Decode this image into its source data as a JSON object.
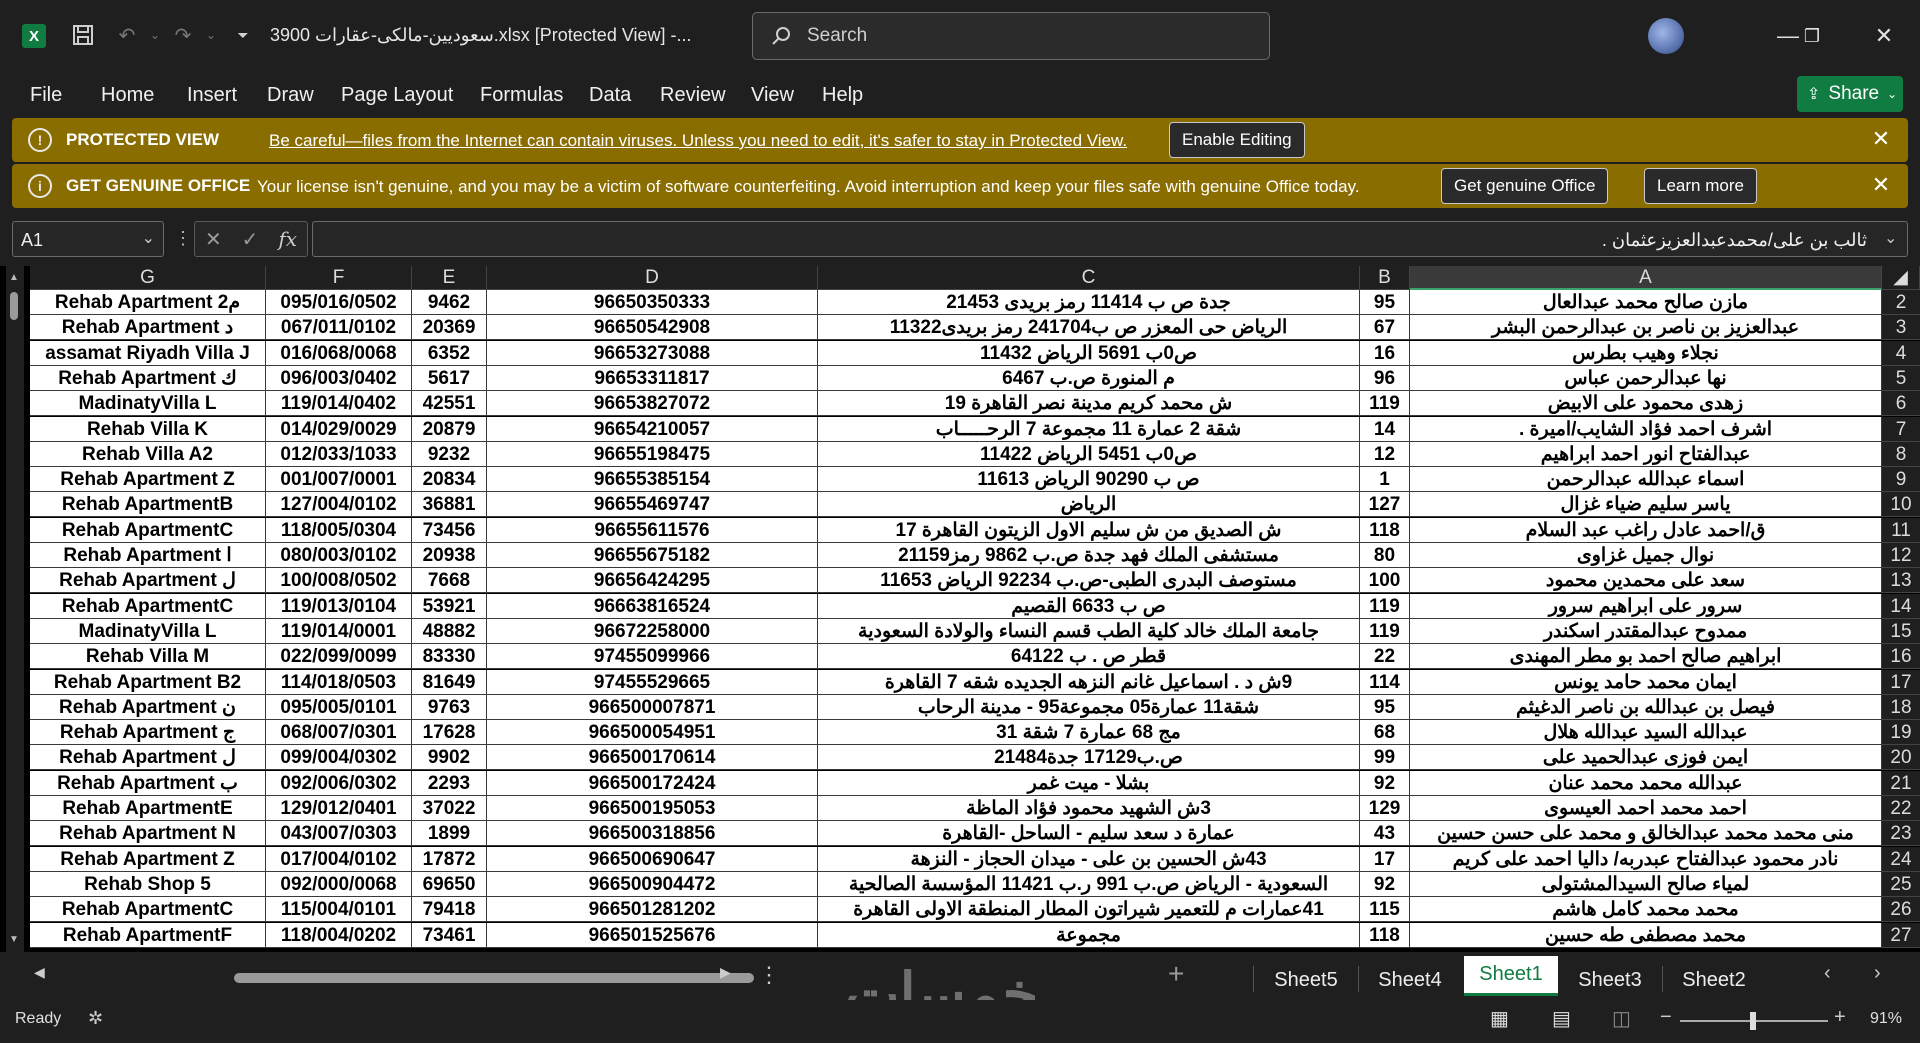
{
  "titlebar": {
    "app_letter": "X",
    "title": "3900 سعوديين-مالكى-عقارات.xlsx  [Protected View]  -...",
    "search_placeholder": "Search"
  },
  "menu": [
    "File",
    "Home",
    "Insert",
    "Draw",
    "Page Layout",
    "Formulas",
    "Data",
    "Review",
    "View",
    "Help"
  ],
  "share_label": "Share",
  "protected_bar": {
    "title": "PROTECTED VIEW",
    "text": "Be careful—files from the Internet can contain viruses. Unless you need to edit, it's safer to stay in Protected View.",
    "button": "Enable Editing"
  },
  "genuine_bar": {
    "title": "GET GENUINE OFFICE",
    "text": "Your license isn't genuine, and you may be a victim of software counterfeiting. Avoid interruption and keep your files safe with genuine Office today.",
    "button1": "Get genuine Office",
    "button2": "Learn more"
  },
  "formula_bar": {
    "name_box": "A1",
    "formula": "ثالب بن على/محمدعبدالعزيزعثمان ."
  },
  "columns": [
    "G",
    "F",
    "E",
    "D",
    "C",
    "B",
    "A"
  ],
  "rows": [
    {
      "n": "2",
      "A": "مازن صالح محمد عبدالعال",
      "B": "95",
      "C": "جدة ص ب 11414 رمز بريدى 21453",
      "D": "96650350333",
      "E": "9462",
      "F": "095/016/0502",
      "G": "Rehab Apartment 2م"
    },
    {
      "n": "3",
      "A": "عبدالعزيز بن ناصر بن عبدالرحمن  البشر",
      "B": "67",
      "C": "الرياض حى المعزر ص ب241704 رمز بريدى11322",
      "D": "96650542908",
      "E": "20369",
      "F": "067/011/0102",
      "G": "Rehab Apartment د"
    },
    {
      "n": "4",
      "A": "نجلاء  وهيب بطرس",
      "B": "16",
      "C": "ص0ب  5691 الرياض 11432",
      "D": "96653273088",
      "E": "6352",
      "F": "016/068/0068",
      "G": "assamat Riyadh Villa J"
    },
    {
      "n": "5",
      "A": "نها  عبدالرحمن عباس",
      "B": "96",
      "C": "م المنورة ص.ب 6467",
      "D": "96653311817",
      "E": "5617",
      "F": "096/003/0402",
      "G": "Rehab Apartment ك"
    },
    {
      "n": "6",
      "A": "زهدى محمود على الابيض",
      "B": "119",
      "C": "ش محمد كريم مدينة نصر القاهرة 19",
      "D": "96653827072",
      "E": "42551",
      "F": "119/014/0402",
      "G": "MadinatyVilla L"
    },
    {
      "n": "7",
      "A": "اشرف احمد فؤاد الشايب/اميرة .",
      "B": "14",
      "C": "شقة 2 عمارة 11 مجموعة 7 الرحـــــاب",
      "D": "96654210057",
      "E": "20879",
      "F": "014/029/0029",
      "G": "Rehab Villa K"
    },
    {
      "n": "8",
      "A": "عبدالفتاح  انور احمد ابراهيم",
      "B": "12",
      "C": "ص0ب 5451 الرياض 11422",
      "D": "96655198475",
      "E": "9232",
      "F": "012/033/1033",
      "G": "Rehab Villa A2"
    },
    {
      "n": "9",
      "A": "اسماء  عبدالله عبدالرحمن",
      "B": "1",
      "C": "ص ب 90290 الرياض 11613",
      "D": "96655385154",
      "E": "20834",
      "F": "001/007/0001",
      "G": "Rehab Apartment Z"
    },
    {
      "n": "10",
      "A": "ياسر سليم ضياء غزال",
      "B": "127",
      "C": "الرياض",
      "D": "96655469747",
      "E": "36881",
      "F": "127/004/0102",
      "G": "Rehab ApartmentB"
    },
    {
      "n": "11",
      "A": "ق/احمد عادل راغب عبد السلام",
      "B": "118",
      "C": "ش الصديق من ش سليم الاول الزيتون القاهرة 17",
      "D": "96655611576",
      "E": "73456",
      "F": "118/005/0304",
      "G": "Rehab ApartmentC"
    },
    {
      "n": "12",
      "A": "نوال  جميل غزاوى",
      "B": "80",
      "C": "مستشفى الملك فهد جدة ص.ب 9862 رمز21159",
      "D": "96655675182",
      "E": "20938",
      "F": "080/003/0102",
      "G": "Rehab Apartment ا"
    },
    {
      "n": "13",
      "A": "سعد على محمدين محمود",
      "B": "100",
      "C": "مستوصف البدرى الطبى-ص.ب 92234 الرياض 11653",
      "D": "96656424295",
      "E": "7668",
      "F": "100/008/0502",
      "G": "Rehab Apartment ل"
    },
    {
      "n": "14",
      "A": "سرور على ابراهيم سرور",
      "B": "119",
      "C": "ص ب 6633 القصيم",
      "D": "96663816524",
      "E": "53921",
      "F": "119/013/0104",
      "G": "Rehab ApartmentC"
    },
    {
      "n": "15",
      "A": "ممدوح عبدالمقتدر اسكندر",
      "B": "119",
      "C": "جامعة الملك خالد  كلية الطب  قسم النساء والولادة  السعودية",
      "D": "96672258000",
      "E": "48882",
      "F": "119/014/0001",
      "G": "MadinatyVilla L"
    },
    {
      "n": "16",
      "A": "ابراهيم صالح احمد بو مطر المهندى",
      "B": "22",
      "C": "قطر ص . ب 64122",
      "D": "97455099966",
      "E": "83330",
      "F": "022/099/0099",
      "G": "Rehab Villa M"
    },
    {
      "n": "17",
      "A": "ايمان محمد حامد يونس",
      "B": "114",
      "C": "9ش د . اسماعيل غانم النزهه الجديده شقه 7 القاهرة",
      "D": "97455529665",
      "E": "81649",
      "F": "114/018/0503",
      "G": "Rehab Apartment B2"
    },
    {
      "n": "18",
      "A": "فيصل بن عبدالله بن ناصر الدغيثم",
      "B": "95",
      "C": "شقة11 عمارة05 مجموعة95 - مدينة الرحاب",
      "D": "966500007871",
      "E": "9763",
      "F": "095/005/0101",
      "G": "Rehab Apartment ن"
    },
    {
      "n": "19",
      "A": "عبدالله السيد عبدالله هلال",
      "B": "68",
      "C": "مج 68 عمارة 7 شقة 31",
      "D": "966500054951",
      "E": "17628",
      "F": "068/007/0301",
      "G": "Rehab Apartment ج"
    },
    {
      "n": "20",
      "A": "ايمن  فوزى عبدالحميد على",
      "B": "99",
      "C": "ص.ب17129 جدة21484",
      "D": "966500170614",
      "E": "9902",
      "F": "099/004/0302",
      "G": "Rehab Apartment ل"
    },
    {
      "n": "21",
      "A": "عبدالله محمد محمد عنان",
      "B": "92",
      "C": "بشلا - ميت غمر",
      "D": "966500172424",
      "E": "2293",
      "F": "092/006/0302",
      "G": "Rehab Apartment ب"
    },
    {
      "n": "22",
      "A": "احمد محمد احمد العيسوى",
      "B": "129",
      "C": "3ش الشهيد محمود فؤاد الماظة",
      "D": "966500195053",
      "E": "37022",
      "F": "129/012/0401",
      "G": "Rehab ApartmentE"
    },
    {
      "n": "23",
      "A": "منى محمد محمد عبدالخالق  و  محمد على حسن حسين",
      "B": "43",
      "C": "عمارة د سعد سليم - الساحل -القاهرة",
      "D": "966500318856",
      "E": "1899",
      "F": "043/007/0303",
      "G": "Rehab Apartment N"
    },
    {
      "n": "24",
      "A": "نادر محمود عبدالفتاح عبدربه/ داليا احمد على كريم",
      "B": "17",
      "C": "43ش الحسين بن على - ميدان الحجاز - النزهة",
      "D": "966500690647",
      "E": "17872",
      "F": "017/004/0102",
      "G": "Rehab Apartment Z"
    },
    {
      "n": "25",
      "A": "لمياء صالح السيدالمشتولى",
      "B": "92",
      "C": "السعودية - الرياض ص.ب 991 ر.ب 11421 المؤسسة الصالحية",
      "D": "966500904472",
      "E": "69650",
      "F": "092/000/0068",
      "G": "Rehab Shop 5"
    },
    {
      "n": "26",
      "A": "محمد محمد كامل هاشم",
      "B": "115",
      "C": "41عمارات م للتعمير شيراتون المطار المنطقة الاولى القاهرة",
      "D": "966501281202",
      "E": "79418",
      "F": "115/004/0101",
      "G": "Rehab ApartmentC"
    },
    {
      "n": "27",
      "A": "محمد مصطفى طه حسين",
      "B": "118",
      "C": "مجموعة",
      "D": "966501525676",
      "E": "73461",
      "F": "118/004/0202",
      "G": "Rehab ApartmentF"
    }
  ],
  "sheets": [
    "Sheet5",
    "Sheet4",
    "Sheet1",
    "Sheet3",
    "Sheet2"
  ],
  "active_sheet": "Sheet1",
  "status": {
    "ready": "Ready",
    "zoom": "91%"
  },
  "watermark": "خمسات"
}
